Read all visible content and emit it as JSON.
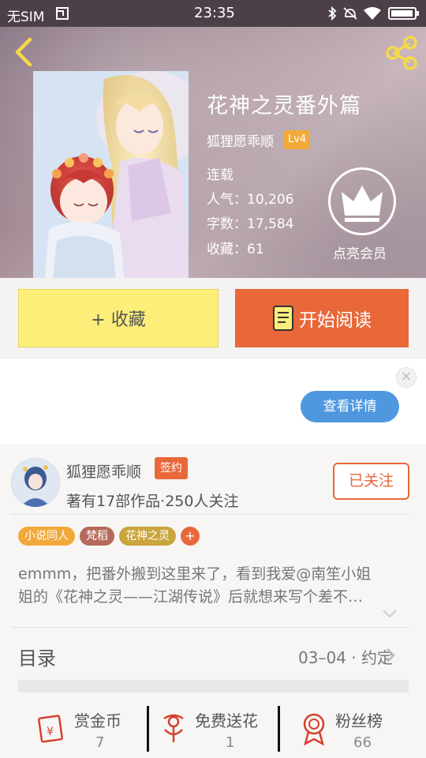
{
  "status_bar": {
    "carrier": "无SIM",
    "time": "23:35",
    "battery_level": 0.95
  },
  "header": {
    "title": "花神之灵番外篇",
    "author": "狐狸愿乖顺",
    "level": "Lv4",
    "status": "连载",
    "popularity": "人气：10,206",
    "word_count": "字数：17,584",
    "favorites": "收藏：61",
    "vip_label": "点亮会员"
  },
  "actions": {
    "favorite_label": "+ 收藏",
    "read_label": "开始阅读"
  },
  "ad": {
    "close_glyph": "×",
    "detail_label": "查看详情"
  },
  "author_card": {
    "name": "狐狸愿乖顺",
    "signed_badge": "签约",
    "stats": "著有17部作品·250人关注",
    "follow_label": "已关注",
    "tags": [
      {
        "label": "小说同人",
        "color": "#f2a93a"
      },
      {
        "label": "梵稻",
        "color": "#b56b5b"
      },
      {
        "label": "花神之灵",
        "color": "#c9a53c"
      }
    ],
    "add_tag": "+",
    "synopsis_line1": "emmm，把番外搬到这里来了，看到我爱@南笙小姐",
    "synopsis_line2": "姐的《花神之灵——江湖传说》后就想来写个差不…"
  },
  "toc": {
    "label": "目录",
    "latest": "03–04 · 约定"
  },
  "bottom_bar": {
    "reward": {
      "label": "赏金币",
      "count": "7"
    },
    "flowers": {
      "label": "免费送花",
      "count": "1"
    },
    "fans": {
      "label": "粉丝榜",
      "count": "66"
    }
  },
  "colors": {
    "accent": "#e8683a",
    "favorite_bg": "#fcef79",
    "detail_button": "#4f98e0",
    "level_badge": "#f2a93a"
  },
  "icons": [
    "back-chevron-icon",
    "share-icon",
    "crown-icon",
    "book-icon",
    "coin-envelope-icon",
    "flower-icon",
    "medal-icon",
    "chevron-right-icon",
    "chevron-down-icon"
  ]
}
